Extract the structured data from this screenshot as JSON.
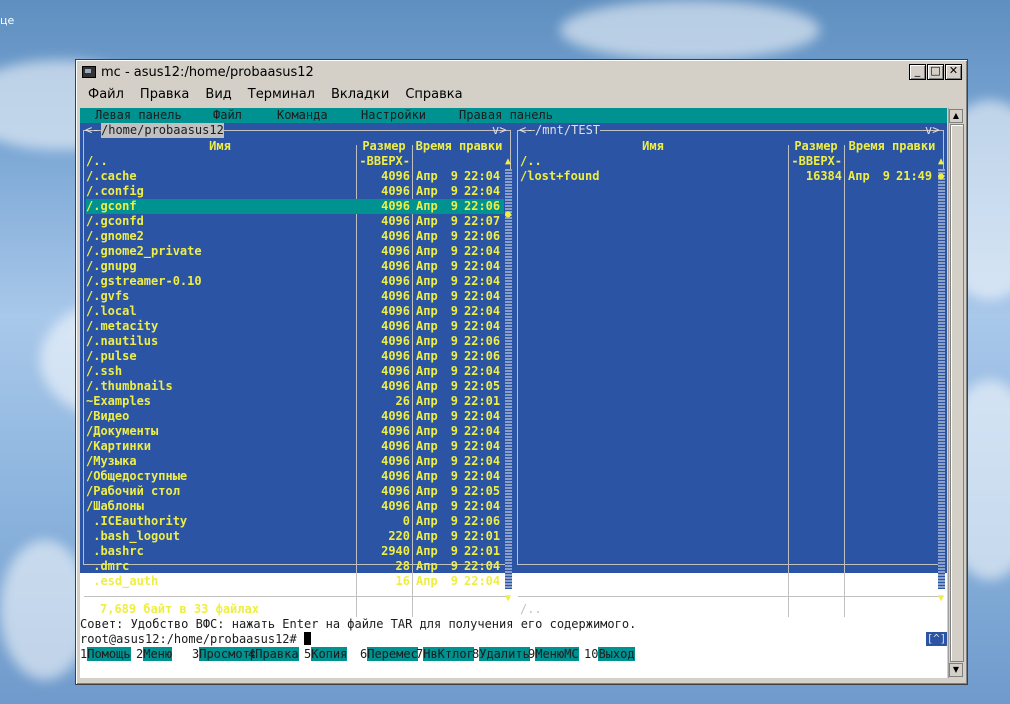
{
  "desktop": {
    "edge_text": "це"
  },
  "window": {
    "title": "mc - asus12:/home/probaasus12",
    "buttons": {
      "minimize": "_",
      "maximize": "□",
      "close": "✕"
    },
    "menubar": [
      "Файл",
      "Правка",
      "Вид",
      "Терминал",
      "Вкладки",
      "Справка"
    ]
  },
  "mc": {
    "top_menu": [
      "Левая панель",
      "Файл",
      "Команда",
      "Настройки",
      "Правая панель"
    ],
    "left": {
      "path": "/home/probaasus12",
      "path_left": "<-",
      "path_right": "v>",
      "headers": {
        "name": "Имя",
        "size": "Размер",
        "time": "Время правки"
      },
      "rows": [
        {
          "name": "/..",
          "size": "-ВВЕРХ-",
          "mon": "",
          "day": "",
          "time": ""
        },
        {
          "name": "/.cache",
          "size": "4096",
          "mon": "Апр",
          "day": "9",
          "time": "22:04"
        },
        {
          "name": "/.config",
          "size": "4096",
          "mon": "Апр",
          "day": "9",
          "time": "22:04"
        },
        {
          "name": "/.gconf",
          "size": "4096",
          "mon": "Апр",
          "day": "9",
          "time": "22:06"
        },
        {
          "name": "/.gconfd",
          "size": "4096",
          "mon": "Апр",
          "day": "9",
          "time": "22:07"
        },
        {
          "name": "/.gnome2",
          "size": "4096",
          "mon": "Апр",
          "day": "9",
          "time": "22:06"
        },
        {
          "name": "/.gnome2_private",
          "size": "4096",
          "mon": "Апр",
          "day": "9",
          "time": "22:04"
        },
        {
          "name": "/.gnupg",
          "size": "4096",
          "mon": "Апр",
          "day": "9",
          "time": "22:04"
        },
        {
          "name": "/.gstreamer-0.10",
          "size": "4096",
          "mon": "Апр",
          "day": "9",
          "time": "22:04"
        },
        {
          "name": "/.gvfs",
          "size": "4096",
          "mon": "Апр",
          "day": "9",
          "time": "22:04"
        },
        {
          "name": "/.local",
          "size": "4096",
          "mon": "Апр",
          "day": "9",
          "time": "22:04"
        },
        {
          "name": "/.metacity",
          "size": "4096",
          "mon": "Апр",
          "day": "9",
          "time": "22:04"
        },
        {
          "name": "/.nautilus",
          "size": "4096",
          "mon": "Апр",
          "day": "9",
          "time": "22:06"
        },
        {
          "name": "/.pulse",
          "size": "4096",
          "mon": "Апр",
          "day": "9",
          "time": "22:06"
        },
        {
          "name": "/.ssh",
          "size": "4096",
          "mon": "Апр",
          "day": "9",
          "time": "22:04"
        },
        {
          "name": "/.thumbnails",
          "size": "4096",
          "mon": "Апр",
          "day": "9",
          "time": "22:05"
        },
        {
          "name": "~Examples",
          "size": "26",
          "mon": "Апр",
          "day": "9",
          "time": "22:01"
        },
        {
          "name": "/Видео",
          "size": "4096",
          "mon": "Апр",
          "day": "9",
          "time": "22:04"
        },
        {
          "name": "/Документы",
          "size": "4096",
          "mon": "Апр",
          "day": "9",
          "time": "22:04"
        },
        {
          "name": "/Картинки",
          "size": "4096",
          "mon": "Апр",
          "day": "9",
          "time": "22:04"
        },
        {
          "name": "/Музыка",
          "size": "4096",
          "mon": "Апр",
          "day": "9",
          "time": "22:04"
        },
        {
          "name": "/Общедоступные",
          "size": "4096",
          "mon": "Апр",
          "day": "9",
          "time": "22:04"
        },
        {
          "name": "/Рабочий стол",
          "size": "4096",
          "mon": "Апр",
          "day": "9",
          "time": "22:05"
        },
        {
          "name": "/Шаблоны",
          "size": "4096",
          "mon": "Апр",
          "day": "9",
          "time": "22:04"
        },
        {
          "name": " .ICEauthority",
          "size": "0",
          "mon": "Апр",
          "day": "9",
          "time": "22:06"
        },
        {
          "name": " .bash_logout",
          "size": "220",
          "mon": "Апр",
          "day": "9",
          "time": "22:01"
        },
        {
          "name": " .bashrc",
          "size": "2940",
          "mon": "Апр",
          "day": "9",
          "time": "22:01"
        },
        {
          "name": " .dmrc",
          "size": "28",
          "mon": "Апр",
          "day": "9",
          "time": "22:04"
        },
        {
          "name": " .esd_auth",
          "size": "16",
          "mon": "Апр",
          "day": "9",
          "time": "22:04"
        }
      ],
      "selected_index": 3,
      "footer": "7,689 байт в 33 файлах"
    },
    "right": {
      "path": "/mnt/TEST",
      "path_left": "<-",
      "path_right": "v>",
      "headers": {
        "name": "Имя",
        "size": "Размер",
        "time": "Время правки"
      },
      "rows": [
        {
          "name": "/..",
          "size": "-ВВЕРХ-",
          "mon": "",
          "day": "",
          "time": ""
        },
        {
          "name": "/lost+found",
          "size": "16384",
          "mon": "Апр",
          "day": "9",
          "time": "21:49"
        }
      ],
      "footer": "/.."
    },
    "hint": "Совет: Удобство ВФС: нажать Enter на файле TAR для получения его содержимого.",
    "prompt": "root@asus12:/home/probaasus12#",
    "history_button": "[^]",
    "fkeys": [
      {
        "num": "1",
        "label": "Помощь"
      },
      {
        "num": "2",
        "label": "Меню"
      },
      {
        "num": "3",
        "label": "Просмотр"
      },
      {
        "num": "4",
        "label": "Правка"
      },
      {
        "num": "5",
        "label": "Копия"
      },
      {
        "num": "6",
        "label": "Перемес"
      },
      {
        "num": "7",
        "label": "НвКтлог"
      },
      {
        "num": "8",
        "label": "Удалить"
      },
      {
        "num": "9",
        "label": "МенюМС"
      },
      {
        "num": "10",
        "label": "Выход"
      }
    ]
  }
}
